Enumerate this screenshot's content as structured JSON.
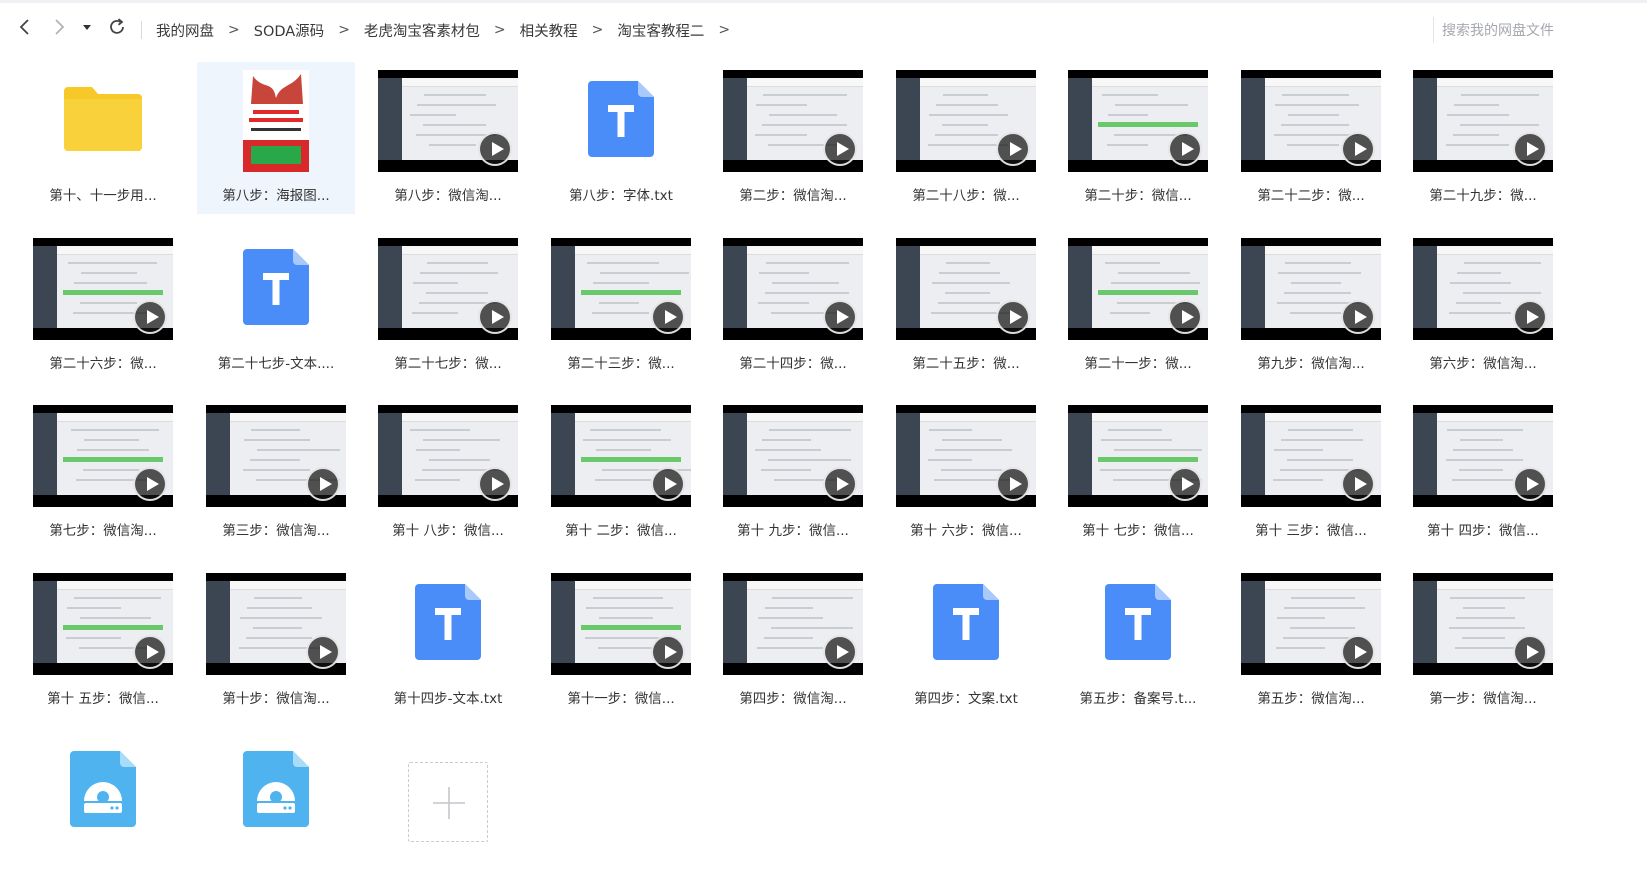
{
  "breadcrumb": [
    "我的网盘",
    "SODA源码",
    "老虎淘宝客素材包",
    "相关教程",
    "淘宝客教程二"
  ],
  "breadcrumb_sep": ">",
  "search": {
    "placeholder": "搜索我的网盘文件"
  },
  "colors": {
    "folder": "#f7c928",
    "txt": "#4b8df8",
    "zip": "#4fb3f0",
    "selected_bg": "#eef5fd"
  },
  "files": [
    {
      "type": "folder",
      "label": "第十、十一步用..."
    },
    {
      "type": "image",
      "label": "第八步：海报图...",
      "selected": true
    },
    {
      "type": "video",
      "label": "第八步：微信淘..."
    },
    {
      "type": "txt",
      "label": "第八步：字体.txt"
    },
    {
      "type": "video",
      "label": "第二步：微信淘..."
    },
    {
      "type": "video",
      "label": "第二十八步：微..."
    },
    {
      "type": "video",
      "label": "第二十步：微信..."
    },
    {
      "type": "video",
      "label": "第二十二步：微..."
    },
    {
      "type": "video",
      "label": "第二十九步：微..."
    },
    {
      "type": "video",
      "label": "第二十六步：微..."
    },
    {
      "type": "txt",
      "label": "第二十七步-文本...."
    },
    {
      "type": "video",
      "label": "第二十七步：微..."
    },
    {
      "type": "video",
      "label": "第二十三步：微..."
    },
    {
      "type": "video",
      "label": "第二十四步：微..."
    },
    {
      "type": "video",
      "label": "第二十五步：微..."
    },
    {
      "type": "video",
      "label": "第二十一步：微..."
    },
    {
      "type": "video",
      "label": "第九步：微信淘..."
    },
    {
      "type": "video",
      "label": "第六步：微信淘..."
    },
    {
      "type": "video",
      "label": "第七步：微信淘..."
    },
    {
      "type": "video",
      "label": "第三步：微信淘..."
    },
    {
      "type": "video",
      "label": "第十 八步：微信..."
    },
    {
      "type": "video",
      "label": "第十 二步：微信..."
    },
    {
      "type": "video",
      "label": "第十 九步：微信..."
    },
    {
      "type": "video",
      "label": "第十 六步：微信..."
    },
    {
      "type": "video",
      "label": "第十 七步：微信..."
    },
    {
      "type": "video",
      "label": "第十 三步：微信..."
    },
    {
      "type": "video",
      "label": "第十 四步：微信..."
    },
    {
      "type": "video",
      "label": "第十 五步：微信..."
    },
    {
      "type": "video",
      "label": "第十步：微信淘..."
    },
    {
      "type": "txt",
      "label": "第十四步-文本.txt"
    },
    {
      "type": "video",
      "label": "第十一步：微信..."
    },
    {
      "type": "video",
      "label": "第四步：微信淘..."
    },
    {
      "type": "txt",
      "label": "第四步：文案.txt"
    },
    {
      "type": "txt",
      "label": "第五步：备案号.t..."
    },
    {
      "type": "video",
      "label": "第五步：微信淘..."
    },
    {
      "type": "video",
      "label": "第一步：微信淘..."
    },
    {
      "type": "zip",
      "label": ""
    },
    {
      "type": "zip",
      "label": ""
    },
    {
      "type": "add",
      "label": ""
    }
  ]
}
